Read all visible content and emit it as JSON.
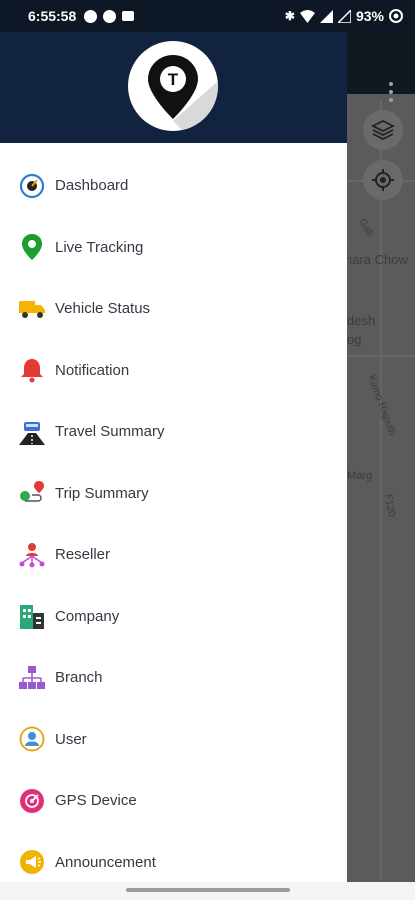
{
  "status_bar": {
    "time": "6:55:58",
    "battery": "93%"
  },
  "app": {
    "logo_letter": "T"
  },
  "map": {
    "labels": [
      "Gali",
      "hara Chow",
      "desh",
      "og",
      "Kamo Rajputh",
      "Marg",
      "F120"
    ]
  },
  "menu": {
    "items": [
      {
        "label": "Dashboard",
        "icon": "speedometer-icon"
      },
      {
        "label": "Live Tracking",
        "icon": "location-pin-icon"
      },
      {
        "label": "Vehicle Status",
        "icon": "truck-icon"
      },
      {
        "label": "Notification",
        "icon": "bell-icon"
      },
      {
        "label": "Travel Summary",
        "icon": "road-car-icon"
      },
      {
        "label": "Trip Summary",
        "icon": "route-icon"
      },
      {
        "label": "Reseller",
        "icon": "network-icon"
      },
      {
        "label": "Company",
        "icon": "building-icon"
      },
      {
        "label": "Branch",
        "icon": "hierarchy-icon"
      },
      {
        "label": "User",
        "icon": "user-icon"
      },
      {
        "label": "GPS Device",
        "icon": "gps-device-icon"
      },
      {
        "label": "Announcement",
        "icon": "megaphone-icon"
      }
    ]
  },
  "colors": {
    "header_bg": "#11233f",
    "status_bg": "#0e1726",
    "drawer_bg": "#ffffff",
    "label_text": "#333a44"
  }
}
